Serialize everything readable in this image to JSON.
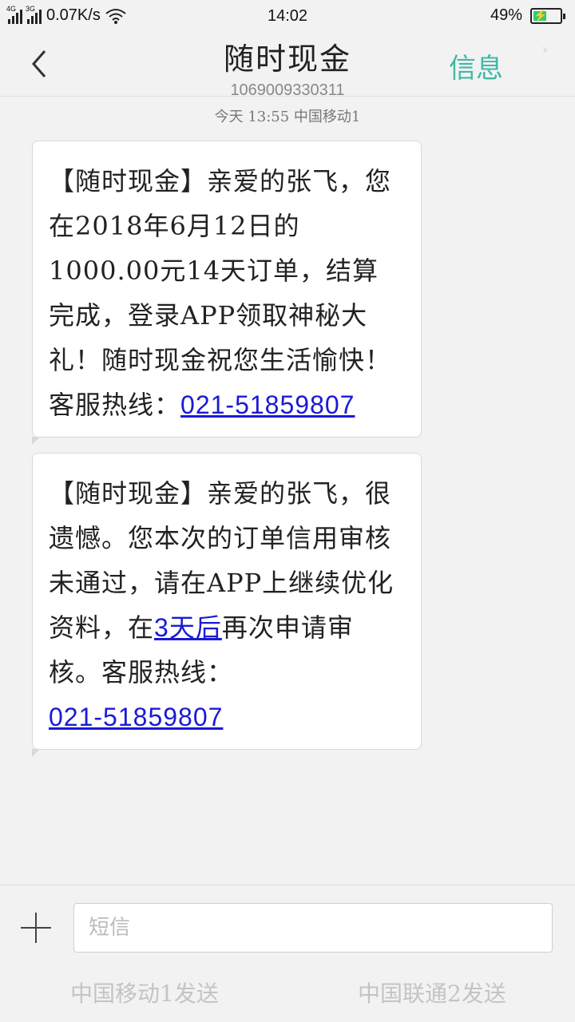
{
  "status": {
    "net_tag_1": "4G",
    "net_tag_2": "3G",
    "speed": "0.07K/s",
    "time": "14:02",
    "battery": "49%"
  },
  "header": {
    "title": "随时现金",
    "number": "1069009330311",
    "info_label": "信息"
  },
  "date_line": "今天  13:55  中国移动1",
  "messages": [
    {
      "text": "【随时现金】亲爱的张飞，您在2018年6月12日的1000.00元14天订单，结算完成，登录APP领取神秘大礼！随时现金祝您生活愉快！客服热线：",
      "link": "021-51859807"
    },
    {
      "text_before": "【随时现金】亲爱的张飞，很遗憾。您本次的订单信用审核未通过，请在APP上继续优化资料，在",
      "date_link": "3天后",
      "text_after": "再次申请审核。客服热线：",
      "link": "021-51859807"
    }
  ],
  "composer": {
    "placeholder": "短信",
    "send_sim1": "中国移动1发送",
    "send_sim2": "中国联通2发送"
  },
  "colors": {
    "accent": "#3fb8a6",
    "link": "#1a1ad6",
    "battery": "#2ecc71"
  }
}
